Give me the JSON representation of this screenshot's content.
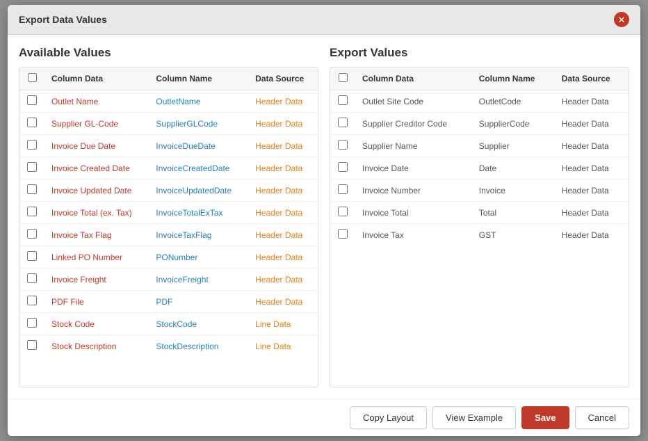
{
  "modal": {
    "title": "Export Data Values",
    "close_label": "×"
  },
  "footer": {
    "copy_layout_label": "Copy Layout",
    "view_example_label": "View Example",
    "save_label": "Save",
    "cancel_label": "Cancel"
  },
  "available_panel": {
    "title": "Available Values",
    "table": {
      "headers": [
        "",
        "Column Data",
        "Column Name",
        "Data Source"
      ],
      "rows": [
        {
          "col_data": "Outlet Name",
          "col_name": "OutletName",
          "source": "Header Data",
          "source_type": "header"
        },
        {
          "col_data": "Supplier GL-Code",
          "col_name": "SupplierGLCode",
          "source": "Header Data",
          "source_type": "header"
        },
        {
          "col_data": "Invoice Due Date",
          "col_name": "InvoiceDueDate",
          "source": "Header Data",
          "source_type": "header"
        },
        {
          "col_data": "Invoice Created Date",
          "col_name": "InvoiceCreatedDate",
          "source": "Header Data",
          "source_type": "header"
        },
        {
          "col_data": "Invoice Updated Date",
          "col_name": "InvoiceUpdatedDate",
          "source": "Header Data",
          "source_type": "header"
        },
        {
          "col_data": "Invoice Total (ex. Tax)",
          "col_name": "InvoiceTotalExTax",
          "source": "Header Data",
          "source_type": "header"
        },
        {
          "col_data": "Invoice Tax Flag",
          "col_name": "InvoiceTaxFlag",
          "source": "Header Data",
          "source_type": "header"
        },
        {
          "col_data": "Linked PO Number",
          "col_name": "PONumber",
          "source": "Header Data",
          "source_type": "header"
        },
        {
          "col_data": "Invoice Freight",
          "col_name": "InvoiceFreight",
          "source": "Header Data",
          "source_type": "header"
        },
        {
          "col_data": "PDF File",
          "col_name": "PDF",
          "source": "Header Data",
          "source_type": "header"
        },
        {
          "col_data": "Stock Code",
          "col_name": "StockCode",
          "source": "Line Data",
          "source_type": "line"
        },
        {
          "col_data": "Stock Description",
          "col_name": "StockDescription",
          "source": "Line Data",
          "source_type": "line"
        }
      ]
    }
  },
  "export_panel": {
    "title": "Export Values",
    "table": {
      "headers": [
        "",
        "Column Data",
        "Column Name",
        "Data Source"
      ],
      "rows": [
        {
          "col_data": "Outlet Site Code",
          "col_name": "OutletCode",
          "source": "Header Data",
          "source_type": "plain"
        },
        {
          "col_data": "Supplier Creditor Code",
          "col_name": "SupplierCode",
          "source": "Header Data",
          "source_type": "plain"
        },
        {
          "col_data": "Supplier Name",
          "col_name": "Supplier",
          "source": "Header Data",
          "source_type": "plain"
        },
        {
          "col_data": "Invoice Date",
          "col_name": "Date",
          "source": "Header Data",
          "source_type": "plain"
        },
        {
          "col_data": "Invoice Number",
          "col_name": "Invoice",
          "source": "Header Data",
          "source_type": "plain"
        },
        {
          "col_data": "Invoice Total",
          "col_name": "Total",
          "source": "Header Data",
          "source_type": "plain"
        },
        {
          "col_data": "Invoice Tax",
          "col_name": "GST",
          "source": "Header Data",
          "source_type": "plain"
        }
      ]
    }
  }
}
